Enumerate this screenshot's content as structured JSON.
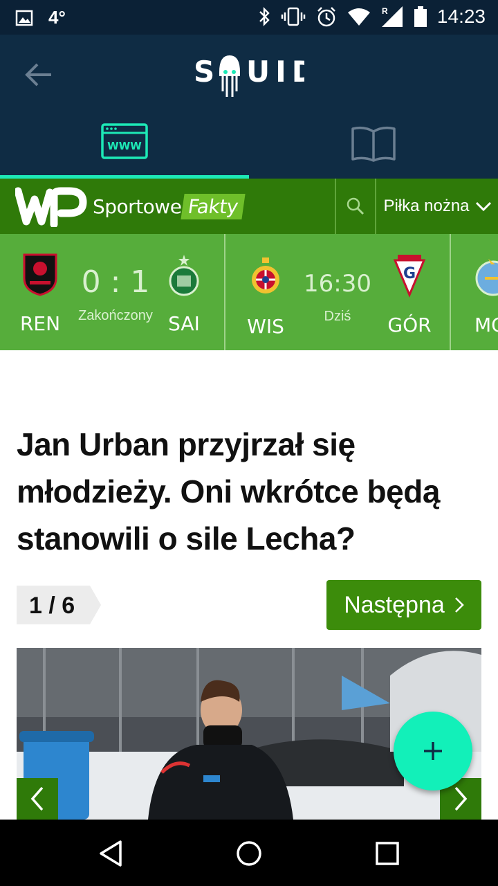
{
  "status_bar": {
    "temperature": "4°",
    "time": "14:23",
    "network_label": "R"
  },
  "app": {
    "name": "SQUID",
    "tabs": [
      {
        "id": "web",
        "icon": "www-icon",
        "label": "WWW",
        "active": true
      },
      {
        "id": "reader",
        "icon": "book-icon",
        "active": false
      }
    ],
    "accent_color": "#1de9b6"
  },
  "site": {
    "logo_text": "WP",
    "name_part1": "Sportowe",
    "name_part2": "Fakty",
    "category": "Piłka nożna"
  },
  "matches": [
    {
      "home": "REN",
      "away": "SAI",
      "score": "0 : 1",
      "status": "Zakończony"
    },
    {
      "home": "WIS",
      "away": "GÓR",
      "score": "16:30",
      "status": "Dziś"
    },
    {
      "home": "MC",
      "away": "",
      "score": "",
      "status": ""
    }
  ],
  "article": {
    "title": "Jan Urban przyjrzał się młodzieży. Oni wkrótce będą stanowili o sile Lecha?",
    "pager": "1 / 6",
    "next_label": "Następna"
  },
  "colors": {
    "header_bg": "#0f2c44",
    "site_green": "#2f7a09",
    "strip_green": "#56ad3b",
    "fab": "#12f0b9"
  }
}
